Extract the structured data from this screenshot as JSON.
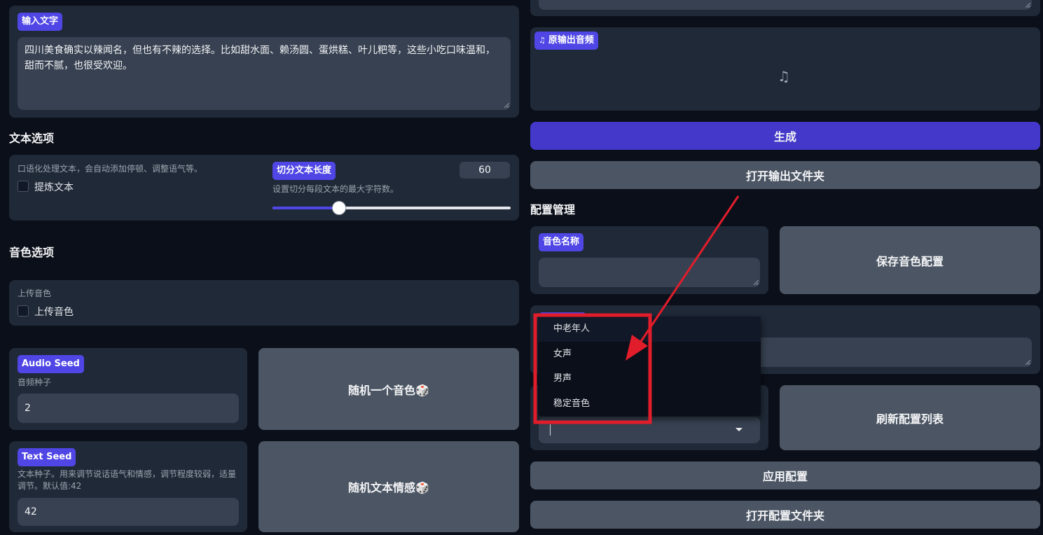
{
  "input_text": {
    "label": "输入文字",
    "value": "四川美食确实以辣闻名，但也有不辣的选择。比如甜水面、赖汤圆、蛋烘糕、叶儿粑等，这些小吃口味温和，甜而不腻，也很受欢迎。"
  },
  "text_options": {
    "heading": "文本选项",
    "refine_desc": "口语化处理文本，会自动添加停顿、调整语气等。",
    "refine_label": "提炼文本",
    "split": {
      "label": "切分文本长度",
      "value": "60",
      "desc": "设置切分每段文本的最大字符数。",
      "slider_fraction": 0.28
    }
  },
  "voice_options": {
    "heading": "音色选项",
    "upload_desc": "上传音色",
    "upload_label": "上传音色"
  },
  "audio_seed": {
    "label": "Audio Seed",
    "desc": "音频种子",
    "value": "2",
    "random_button": "随机一个音色🎲"
  },
  "text_seed": {
    "label": "Text Seed",
    "desc": "文本种子。用来调节说话语气和情感，调节程度较弱，适量调节。默认值:42",
    "value": "42",
    "random_button": "随机文本情感🎲"
  },
  "output": {
    "audio_label": "原输出音频",
    "music_icon": "music-note-icon",
    "generate_button": "生成",
    "open_folder_button": "打开输出文件夹"
  },
  "config": {
    "heading": "配置管理",
    "voice_name_label": "音色名称",
    "voice_name_value": "",
    "save_button": "保存音色配置",
    "refresh_button": "刷新配置列表",
    "apply_button": "应用配置",
    "open_config_folder_button": "打开配置文件夹",
    "dropdown_options": [
      "中老年人",
      "女声",
      "男声",
      "稳定音色"
    ],
    "highlighted_option": "中老年人"
  },
  "colors": {
    "accent": "#4f46e5",
    "annotation": "#e11d2b",
    "panel": "#1f2937",
    "background": "#0b0f19"
  }
}
